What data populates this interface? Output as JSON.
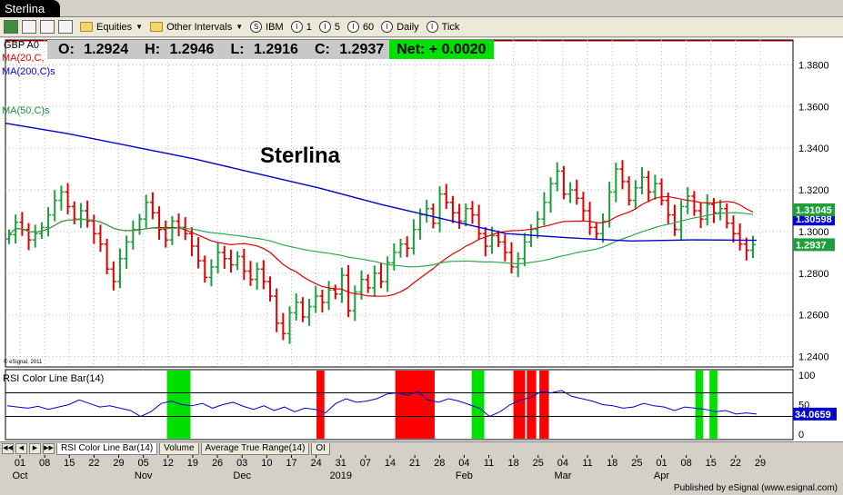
{
  "window": {
    "title": "Sterlina"
  },
  "toolbar": {
    "items": [
      {
        "icon": "folder-icon",
        "label": "Equities",
        "dropdown": true
      },
      {
        "icon": "folder-icon",
        "label": "Other Intervals",
        "dropdown": true
      },
      {
        "icon": "circle-s-icon",
        "glyph": "S",
        "label": "IBM"
      },
      {
        "icon": "circle-i-icon",
        "glyph": "I",
        "label": "1"
      },
      {
        "icon": "circle-i-icon",
        "glyph": "I",
        "label": "5"
      },
      {
        "icon": "circle-i-icon",
        "glyph": "I",
        "label": "60"
      },
      {
        "icon": "circle-i-icon",
        "glyph": "I",
        "label": "Daily"
      },
      {
        "icon": "circle-i-icon",
        "glyph": "I",
        "label": "Tick"
      }
    ]
  },
  "header": {
    "symbol": "GBP A0",
    "open_label": "O:",
    "open": "1.2924",
    "high_label": "H:",
    "high": "1.2946",
    "low_label": "L:",
    "low": "1.2916",
    "close_label": "C:",
    "close": "1.2937",
    "net_label": "Net:",
    "net": "+ 0.0020"
  },
  "studies": {
    "ma20": "MA(20,C,",
    "ma200": "MA(200,C)s",
    "ma50": "MA(50,C)s",
    "credit": "© eSignal, 2011",
    "rsi": "RSI Color Line Bar(14)"
  },
  "annotation": "Sterlina",
  "chart_data": {
    "type": "ohlc",
    "title": "Sterlina",
    "ylim": [
      1.235,
      1.392
    ],
    "y_ticks": [
      "1.3800",
      "1.3600",
      "1.3400",
      "1.3200",
      "1.3000",
      "1.2800",
      "1.2600",
      "1.2400"
    ],
    "y_tick_values": [
      1.38,
      1.36,
      1.34,
      1.32,
      1.3,
      1.28,
      1.26,
      1.24
    ],
    "last_labels": {
      "ma50": "1.31045",
      "ma200_partial": "1.30598",
      "close": "1.2937"
    },
    "ma200_value": 1.30598,
    "ma50_value": 1.31045,
    "close_value": 1.2937,
    "rsi_ticks": [
      "100",
      "50",
      "0"
    ],
    "rsi_value": "34.0659",
    "rsi_levels": [
      70,
      30
    ],
    "x_day_labels": [
      "01",
      "08",
      "15",
      "22",
      "29",
      "05",
      "12",
      "19",
      "26",
      "03",
      "10",
      "17",
      "24",
      "31",
      "07",
      "14",
      "21",
      "28",
      "04",
      "11",
      "18",
      "25",
      "04",
      "11",
      "18",
      "25",
      "01",
      "08",
      "15",
      "22",
      "29"
    ],
    "x_month_labels": [
      {
        "label": "Oct",
        "at": 0
      },
      {
        "label": "Nov",
        "at": 5
      },
      {
        "label": "Dec",
        "at": 9
      },
      {
        "label": "2019",
        "at": 13
      },
      {
        "label": "Feb",
        "at": 18
      },
      {
        "label": "Mar",
        "at": 22
      },
      {
        "label": "Apr",
        "at": 26
      }
    ],
    "close_series": [
      1.2985,
      1.3045,
      1.301,
      1.296,
      1.299,
      1.302,
      1.308,
      1.315,
      1.319,
      1.312,
      1.306,
      1.31,
      1.305,
      1.299,
      1.294,
      1.282,
      1.276,
      1.287,
      1.295,
      1.301,
      1.306,
      1.314,
      1.309,
      1.301,
      1.296,
      1.305,
      1.302,
      1.299,
      1.293,
      1.286,
      1.278,
      1.283,
      1.29,
      1.287,
      1.284,
      1.288,
      1.281,
      1.277,
      1.282,
      1.276,
      1.269,
      1.256,
      1.251,
      1.261,
      1.266,
      1.259,
      1.264,
      1.269,
      1.266,
      1.272,
      1.27,
      1.279,
      1.262,
      1.271,
      1.277,
      1.273,
      1.28,
      1.276,
      1.285,
      1.29,
      1.294,
      1.292,
      1.301,
      1.308,
      1.311,
      1.304,
      1.318,
      1.314,
      1.309,
      1.305,
      1.311,
      1.308,
      1.299,
      1.293,
      1.298,
      1.295,
      1.29,
      1.283,
      1.287,
      1.295,
      1.301,
      1.306,
      1.314,
      1.323,
      1.329,
      1.318,
      1.32,
      1.316,
      1.31,
      1.302,
      1.299,
      1.305,
      1.319,
      1.33,
      1.324,
      1.315,
      1.321,
      1.326,
      1.319,
      1.323,
      1.315,
      1.308,
      1.301,
      1.312,
      1.317,
      1.31,
      1.306,
      1.313,
      1.309,
      1.311,
      1.304,
      1.299,
      1.294,
      1.291,
      1.2937
    ],
    "ma200_series": [
      1.352,
      1.347,
      1.341,
      1.335,
      1.328,
      1.321,
      1.313,
      1.306,
      1.299,
      1.297,
      1.2955,
      1.296,
      1.2958
    ],
    "rsi_series": [
      48,
      46,
      44,
      47,
      42,
      46,
      50,
      58,
      52,
      46,
      48,
      44,
      40,
      30,
      38,
      52,
      56,
      50,
      48,
      52,
      44,
      50,
      54,
      47,
      42,
      48,
      40,
      46,
      38,
      44,
      42,
      36,
      52,
      60,
      54,
      56,
      60,
      68,
      70,
      66,
      72,
      58,
      54,
      60,
      56,
      50,
      44,
      30,
      38,
      50,
      58,
      62,
      72,
      70,
      74,
      64,
      60,
      56,
      50,
      48,
      44,
      46,
      52,
      48,
      46,
      40,
      46,
      44,
      42,
      38,
      40,
      34,
      36,
      34.07
    ],
    "rsi_highlights": [
      {
        "from": 0.205,
        "to": 0.235,
        "color": "#00e000"
      },
      {
        "from": 0.395,
        "to": 0.405,
        "color": "#ff0000"
      },
      {
        "from": 0.495,
        "to": 0.545,
        "color": "#ff0000"
      },
      {
        "from": 0.592,
        "to": 0.608,
        "color": "#00e000"
      },
      {
        "from": 0.645,
        "to": 0.66,
        "color": "#ff0000"
      },
      {
        "from": 0.662,
        "to": 0.674,
        "color": "#ff0000"
      },
      {
        "from": 0.678,
        "to": 0.69,
        "color": "#ff0000"
      },
      {
        "from": 0.876,
        "to": 0.886,
        "color": "#00e000"
      },
      {
        "from": 0.894,
        "to": 0.904,
        "color": "#00e000"
      }
    ]
  },
  "tabs": [
    "RSI Color Line Bar(14)",
    "Volume",
    "Average True Range(14)",
    "OI"
  ],
  "footer": {
    "published": "Published by eSignal (www.esignal.com)"
  },
  "colors": {
    "up": "#1e9e3c",
    "down": "#e00000",
    "ma20": "#e00000",
    "ma50": "#2fa84f",
    "ma200": "#0000d0",
    "rsi_line": "#0000d0",
    "net_bg": "#00e000"
  }
}
